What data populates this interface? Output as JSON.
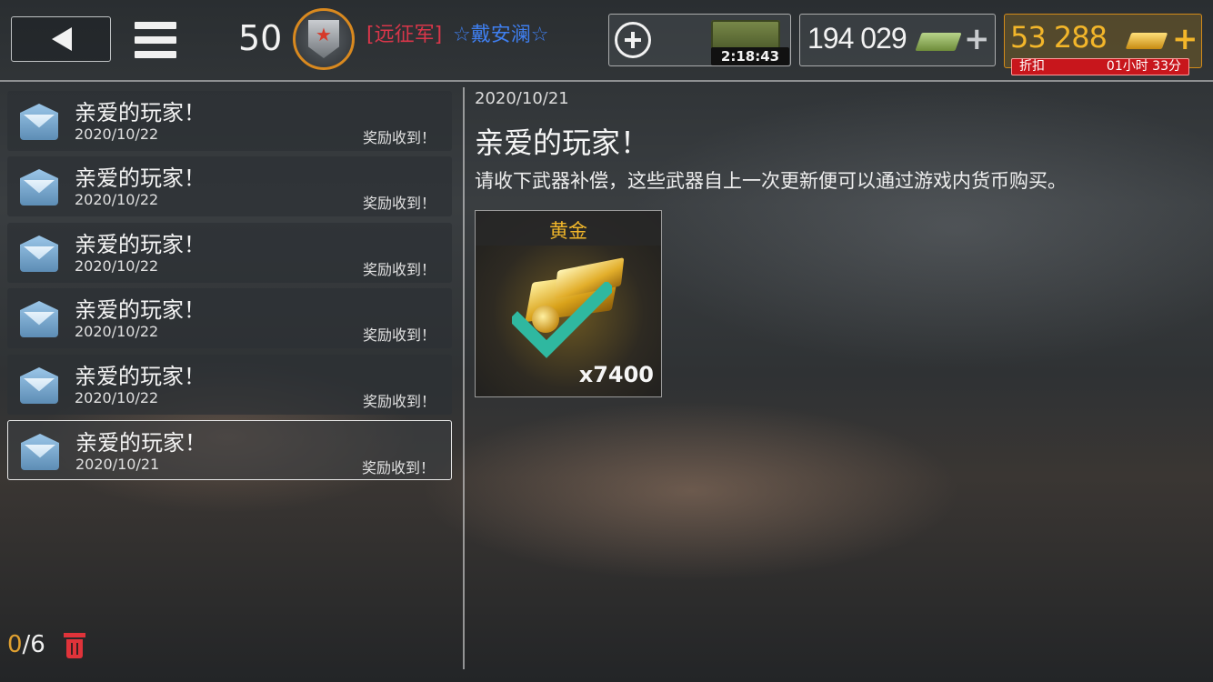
{
  "header": {
    "level": "50",
    "guild": "[远征军]",
    "player_name": "☆戴安澜☆",
    "timer": "2:18:43",
    "cash": "194 029",
    "gold": "53 288",
    "discount_label": "折扣",
    "discount_time": "01小时 33分"
  },
  "mail_list": [
    {
      "title": "亲爱的玩家！",
      "date": "2020/10/22",
      "status": "奖励收到！"
    },
    {
      "title": "亲爱的玩家！",
      "date": "2020/10/22",
      "status": "奖励收到！"
    },
    {
      "title": "亲爱的玩家！",
      "date": "2020/10/22",
      "status": "奖励收到！"
    },
    {
      "title": "亲爱的玩家！",
      "date": "2020/10/22",
      "status": "奖励收到！"
    },
    {
      "title": "亲爱的玩家！",
      "date": "2020/10/22",
      "status": "奖励收到！"
    },
    {
      "title": "亲爱的玩家！",
      "date": "2020/10/21",
      "status": "奖励收到！"
    }
  ],
  "count": {
    "current": "0",
    "total": "/6"
  },
  "detail": {
    "date": "2020/10/21",
    "title": "亲爱的玩家！",
    "body": "请收下武器补偿，这些武器自上一次更新便可以通过游戏内货币购买。",
    "reward_label": "黄金",
    "reward_qty": "x7400"
  },
  "colors": {
    "gold_text": "#f3b62a",
    "guild": "#d9364a",
    "player": "#3f7ff0",
    "claimed_check": "#2fb8a0"
  }
}
